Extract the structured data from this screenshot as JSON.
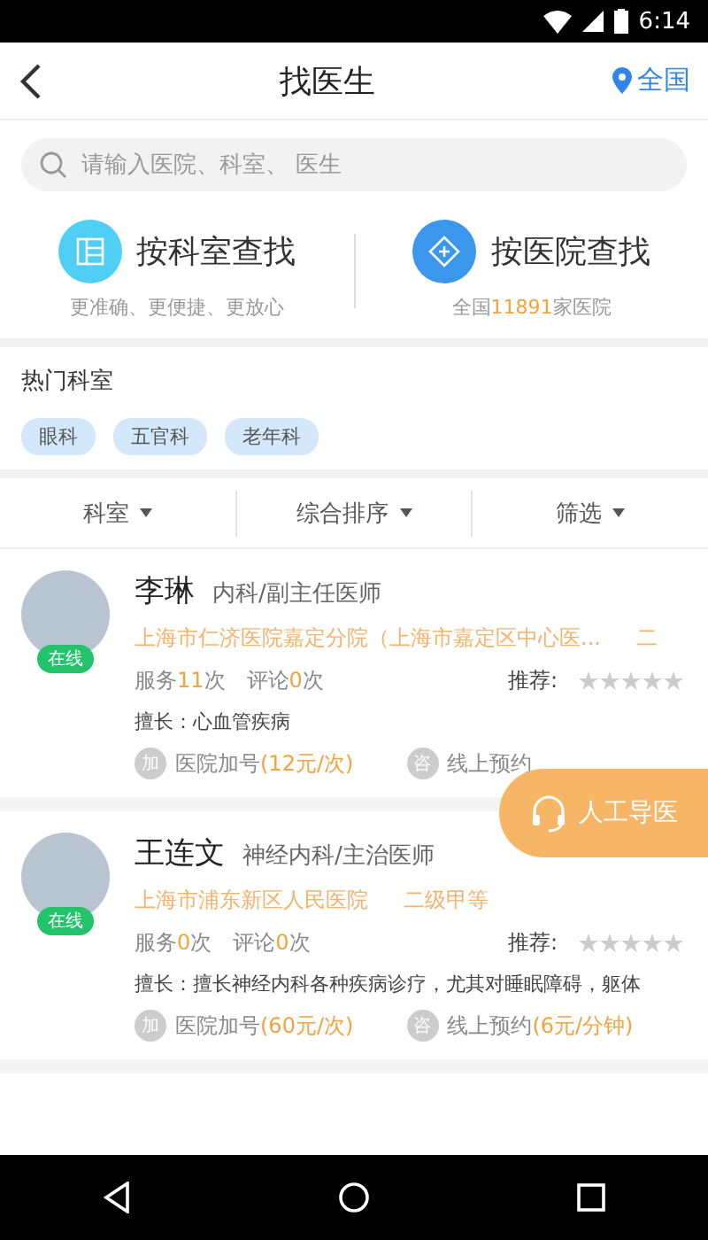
{
  "status_bar": {
    "time": "6:14"
  },
  "header": {
    "title": "找医生",
    "location": "全国"
  },
  "search": {
    "placeholder": "请输入医院、科室、 医生"
  },
  "entries": [
    {
      "kind": "department",
      "title": "按科室查找",
      "subtitle": "更准确、更便捷、更放心"
    },
    {
      "kind": "hospital",
      "title": "按医院查找",
      "subtitle_before": "全国",
      "count": "11891",
      "subtitle_after": "家医院"
    }
  ],
  "hot": {
    "title": "热门科室",
    "tags": [
      "眼科",
      "五官科",
      "老年科"
    ]
  },
  "filters": [
    "科室",
    "综合排序",
    "筛选"
  ],
  "doctors": [
    {
      "name": "李琳",
      "title": "内科/副主任医师",
      "status": "在线",
      "hospital": "上海市仁济医院嘉定分院（上海市嘉定区中心医...",
      "level": "二",
      "service_label": "服务",
      "service_count": "11",
      "service_unit": "次",
      "review_label": "评论",
      "review_count": "0",
      "review_unit": "次",
      "recommend": "推荐:",
      "stars": 0,
      "expertise_label": "擅长：",
      "expertise": "心血管疾病",
      "add_badge": "加",
      "add_label": "医院加号",
      "add_price": "(12元/次)",
      "consult_badge": "咨",
      "consult_label": "线上预约"
    },
    {
      "name": "王连文",
      "title": "神经内科/主治医师",
      "status": "在线",
      "hospital": "上海市浦东新区人民医院",
      "level": "二级甲等",
      "service_label": "服务",
      "service_count": "0",
      "service_unit": "次",
      "review_label": "评论",
      "review_count": "0",
      "review_unit": "次",
      "recommend": "推荐:",
      "stars": 0,
      "expertise_label": "擅长：",
      "expertise": "擅长神经内科各种疾病诊疗，尤其对睡眠障碍，躯体",
      "add_badge": "加",
      "add_label": "医院加号",
      "add_price": "(60元/次)",
      "consult_badge": "咨",
      "consult_label": "线上预约",
      "consult_price": "(6元/分钟)"
    }
  ],
  "fab": {
    "label": "人工导医"
  }
}
